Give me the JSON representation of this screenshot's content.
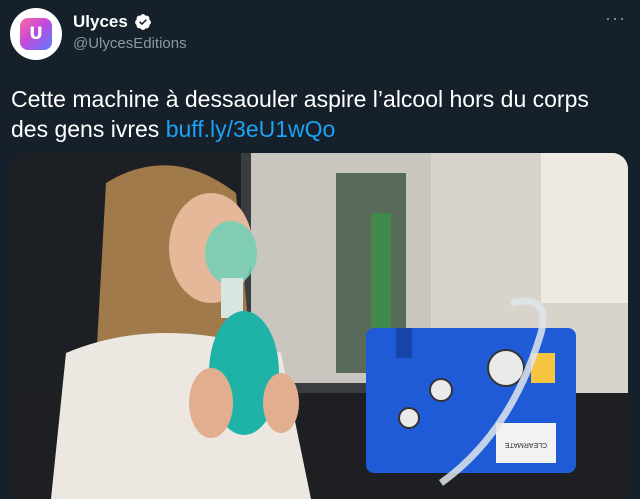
{
  "author": {
    "name": "Ulyces",
    "handle": "@UlycesEditions",
    "avatar_letter": "U",
    "verified_icon": "verified-badge-icon"
  },
  "menu": {
    "more_label": "···"
  },
  "tweet": {
    "text": "Cette machine à dessaouler aspire l’alcool hors du corps des gens ivres",
    "link": "buff.ly/3eU1wQo"
  },
  "media": {
    "device_label": "CLEARMATE",
    "description_icon": "photo-woman-with-mask-and-machine"
  },
  "colors": {
    "background": "#15202b",
    "link": "#1da1f2",
    "secondary_text": "#8899a6",
    "verified": "#ffffff"
  }
}
